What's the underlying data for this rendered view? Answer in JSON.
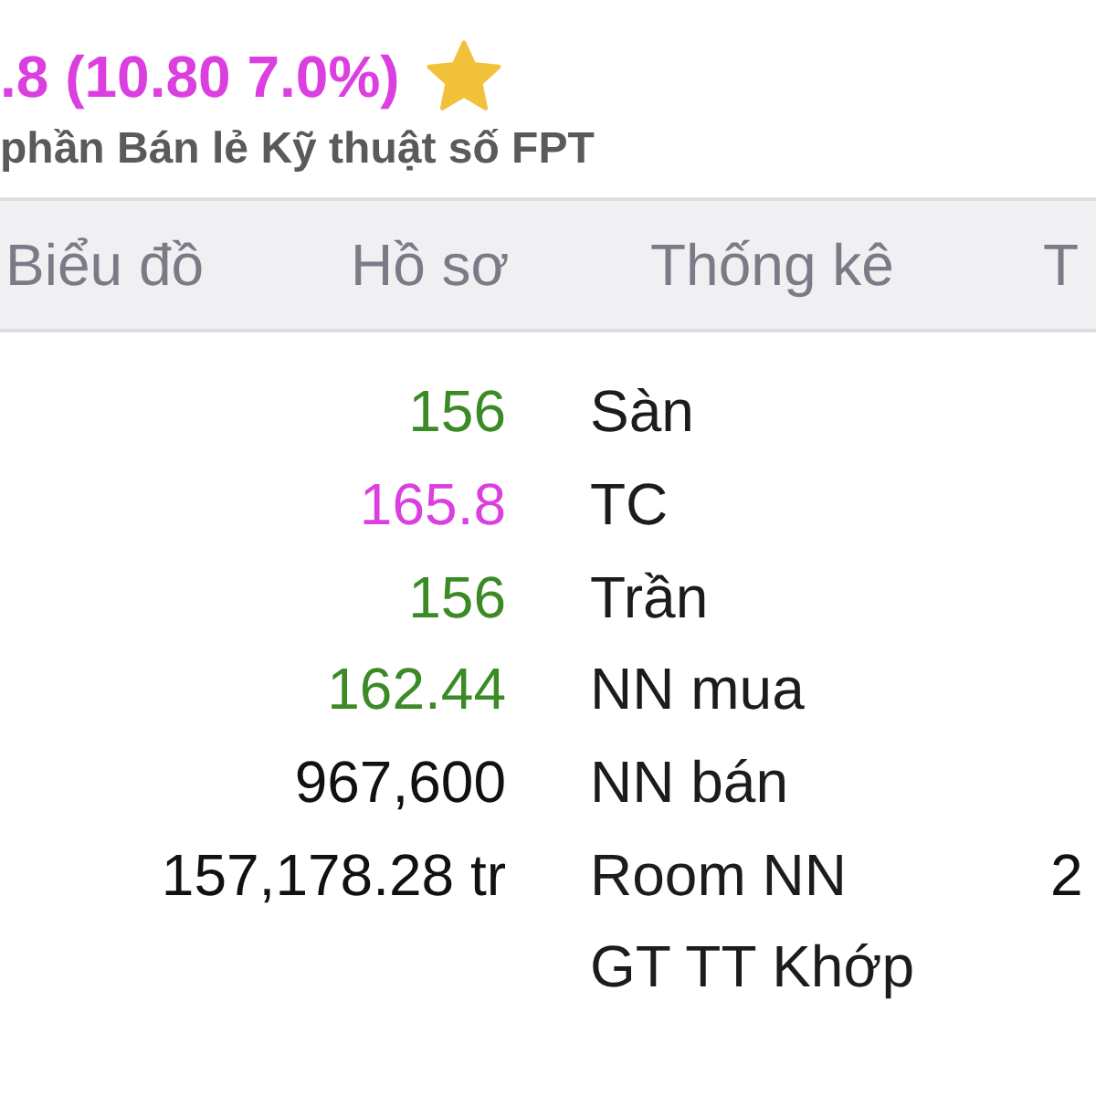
{
  "header": {
    "price": {
      "text": ".8 (10.80 7.0%)",
      "color": "#dc3fe0"
    },
    "favorite": true,
    "company_name": "phần Bán lẻ Kỹ thuật số FPT"
  },
  "tabs": [
    {
      "label": "Biểu đồ"
    },
    {
      "label": "Hồ sơ"
    },
    {
      "label": "Thống kê"
    },
    {
      "label": "T"
    }
  ],
  "stats": [
    {
      "value": "156",
      "color": "#3b8a26",
      "label": "Sàn"
    },
    {
      "value": "165.8",
      "color": "#dc3fe0",
      "label": "TC"
    },
    {
      "value": "156",
      "color": "#3b8a26",
      "label": "Trần"
    },
    {
      "value": "162.44",
      "color": "#3b8a26",
      "label": "NN mua"
    },
    {
      "value": "967,600",
      "color": "#111111",
      "label": "NN bán"
    },
    {
      "value": "157,178.28 tr",
      "color": "#111111",
      "label": "Room NN",
      "column_3": "2"
    },
    {
      "label": "GT TT Khớp"
    }
  ]
}
